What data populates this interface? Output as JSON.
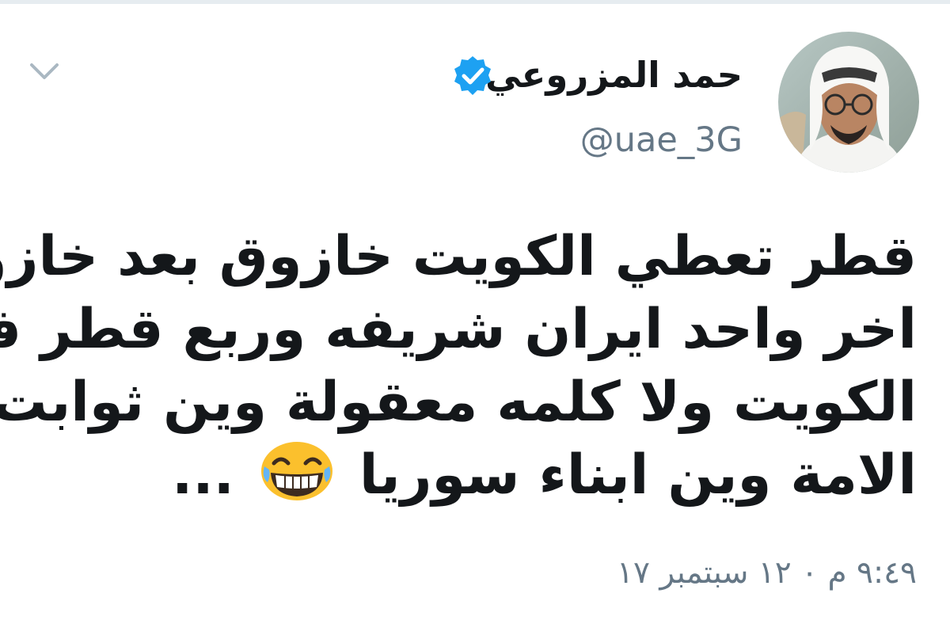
{
  "tweet": {
    "author": {
      "display_name": "حمد المزروعي",
      "handle": "@uae_3G",
      "verified": true
    },
    "text_lines": [
      "قطر تعطي الكويت خازوق بعد خازوق",
      "اخر واحد ايران شريفه وربع قطر في",
      "الكويت ولا كلمه معقولة وين ثوابت",
      "الامة وين ابناء سوريا"
    ],
    "text_trailing": "...",
    "emoji": "laughing-face-emoji",
    "timestamp": "٩:٤٩ م ٠ ١٢ سبتمبر ١٧"
  },
  "colors": {
    "text_primary": "#14171a",
    "text_secondary": "#657786",
    "verified_blue": "#1da1f2",
    "divider": "#e6ecf0",
    "chevron": "#aab8c2"
  },
  "icons": {
    "verified": "verified-badge-icon",
    "menu": "chevron-down-icon"
  }
}
